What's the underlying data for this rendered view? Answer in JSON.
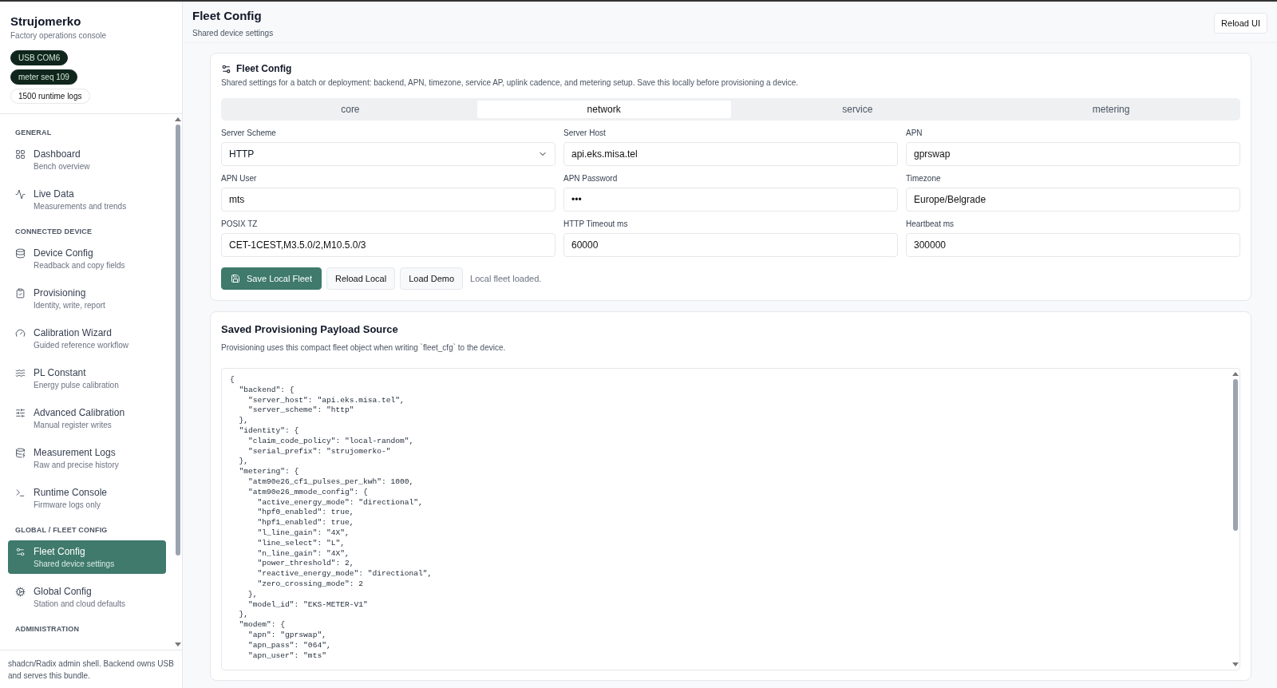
{
  "sidebar": {
    "brand": "Strujomerko",
    "subtitle": "Factory operations console",
    "badges": [
      {
        "label": "USB COM6",
        "kind": "dark"
      },
      {
        "label": "meter seq 109",
        "kind": "dark"
      },
      {
        "label": "1500 runtime logs",
        "kind": "outline"
      }
    ],
    "sections": [
      {
        "heading": "GENERAL",
        "items": [
          {
            "label": "Dashboard",
            "description": "Bench overview",
            "selected": false
          },
          {
            "label": "Live Data",
            "description": "Measurements and trends",
            "selected": false
          }
        ]
      },
      {
        "heading": "CONNECTED DEVICE",
        "items": [
          {
            "label": "Device Config",
            "description": "Readback and copy fields",
            "selected": false
          },
          {
            "label": "Provisioning",
            "description": "Identity, write, report",
            "selected": false
          },
          {
            "label": "Calibration Wizard",
            "description": "Guided reference workflow",
            "selected": false
          },
          {
            "label": "PL Constant",
            "description": "Energy pulse calibration",
            "selected": false
          },
          {
            "label": "Advanced Calibration",
            "description": "Manual register writes",
            "selected": false
          },
          {
            "label": "Measurement Logs",
            "description": "Raw and precise history",
            "selected": false
          },
          {
            "label": "Runtime Console",
            "description": "Firmware logs only",
            "selected": false
          }
        ]
      },
      {
        "heading": "GLOBAL / FLEET CONFIG",
        "items": [
          {
            "label": "Fleet Config",
            "description": "Shared device settings",
            "selected": true
          },
          {
            "label": "Global Config",
            "description": "Station and cloud defaults",
            "selected": false
          }
        ]
      },
      {
        "heading": "ADMINISTRATION"
      }
    ],
    "footer": "shadcn/Radix admin shell. Backend owns USB and serves this bundle."
  },
  "header": {
    "title": "Fleet Config",
    "subtitle": "Shared device settings",
    "button": "Reload UI"
  },
  "fleet_card": {
    "title": "Fleet Config",
    "description": "Shared settings for a batch or deployment: backend, APN, timezone, service AP, uplink cadence, and metering setup. Save this locally before provisioning a device.",
    "tabs": [
      {
        "label": "core",
        "selected": false
      },
      {
        "label": "network",
        "selected": true
      },
      {
        "label": "service",
        "selected": false
      },
      {
        "label": "metering",
        "selected": false
      }
    ],
    "fields": [
      {
        "label": "Server Scheme",
        "kind": "select",
        "value": "HTTP"
      },
      {
        "label": "Server Host",
        "kind": "input",
        "value": "api.eks.misa.tel"
      },
      {
        "label": "APN",
        "kind": "input",
        "value": "gprswap"
      },
      {
        "label": "APN User",
        "kind": "input",
        "value": "mts"
      },
      {
        "label": "APN Password",
        "kind": "input",
        "value": "•••"
      },
      {
        "label": "Timezone",
        "kind": "input",
        "value": "Europe/Belgrade"
      },
      {
        "label": "POSIX TZ",
        "kind": "input",
        "value": "CET-1CEST,M3.5.0/2,M10.5.0/3"
      },
      {
        "label": "HTTP Timeout ms",
        "kind": "input",
        "value": "60000"
      },
      {
        "label": "Heartbeat ms",
        "kind": "input",
        "value": "300000"
      }
    ],
    "buttons": [
      {
        "label": "Save Local Fleet",
        "kind": "primary"
      },
      {
        "label": "Reload Local",
        "kind": "secondary"
      },
      {
        "label": "Load Demo",
        "kind": "secondary"
      }
    ],
    "status": "Local fleet loaded."
  },
  "payload_card": {
    "title": "Saved Provisioning Payload Source",
    "description": "Provisioning uses this compact fleet object when writing `fleet_cfg` to the device.",
    "code": [
      "{",
      "  \"backend\": {",
      "    \"server_host\": \"api.eks.misa.tel\",",
      "    \"server_scheme\": \"http\"",
      "  },",
      "  \"identity\": {",
      "    \"claim_code_policy\": \"local-random\",",
      "    \"serial_prefix\": \"strujomerko-\"",
      "  },",
      "  \"metering\": {",
      "    \"atm90e26_cf1_pulses_per_kwh\": 1000,",
      "    \"atm90e26_mmode_config\": {",
      "      \"active_energy_mode\": \"directional\",",
      "      \"hpf0_enabled\": true,",
      "      \"hpf1_enabled\": true,",
      "      \"l_line_gain\": \"4X\",",
      "      \"line_select\": \"L\",",
      "      \"n_line_gain\": \"4X\",",
      "      \"power_threshold\": 2,",
      "      \"reactive_energy_mode\": \"directional\",",
      "      \"zero_crossing_mode\": 2",
      "    },",
      "    \"model_id\": \"EKS-METER-V1\"",
      "  },",
      "  \"modem\": {",
      "    \"apn\": \"gprswap\",",
      "    \"apn_pass\": \"064\",",
      "    \"apn_user\": \"mts\""
    ]
  }
}
